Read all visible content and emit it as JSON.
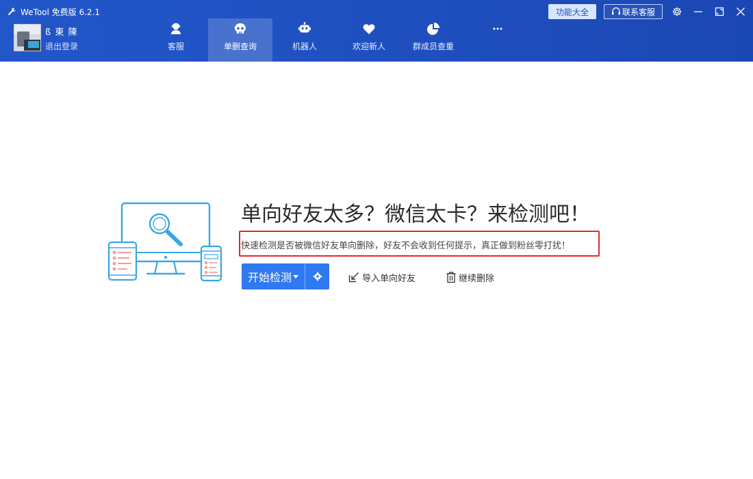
{
  "app": {
    "title": "WeTool 免费版 6.2.1"
  },
  "user": {
    "name": "ß 東 陳",
    "logout": "退出登录"
  },
  "nav": {
    "items": [
      {
        "label": "客服",
        "icon": "headset-icon"
      },
      {
        "label": "单删查询",
        "icon": "skull-icon"
      },
      {
        "label": "机器人",
        "icon": "robot-icon"
      },
      {
        "label": "欢迎新人",
        "icon": "heart-icon"
      },
      {
        "label": "群成员查重",
        "icon": "pie-chart-icon"
      },
      {
        "label": "",
        "icon": "more-icon"
      }
    ],
    "active_index": 1
  },
  "topbar": {
    "features": "功能大全",
    "contact": "联系客服"
  },
  "main": {
    "headline": "单向好友太多？微信太卡？来检测吧！",
    "description": "快速检测是否被微信好友单向删除，好友不会收到任何提示，真正做到粉丝零打扰！",
    "start_button": "开始检测",
    "import_link": "导入单向好友",
    "continue_link": "继续删除"
  },
  "colors": {
    "header_blue": "#2257c9",
    "accent_blue": "#2f79f1",
    "highlight_red": "#e0282b",
    "illustration": "#3aa5e8"
  }
}
